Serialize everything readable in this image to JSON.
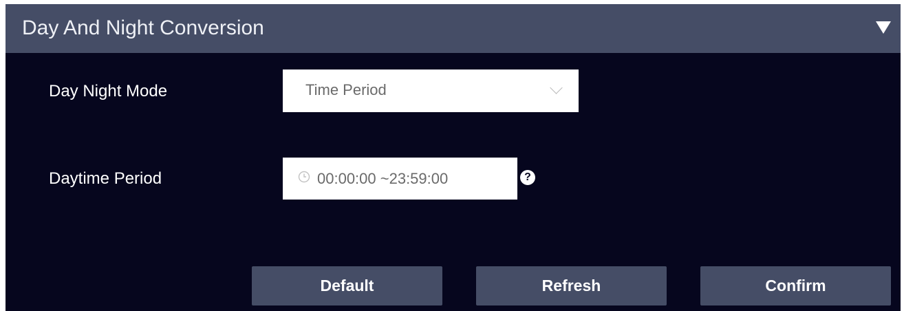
{
  "header": {
    "title": "Day And Night Conversion",
    "collapse_icon": "triangle-down-icon"
  },
  "form": {
    "day_night_mode": {
      "label": "Day Night Mode",
      "value": "Time Period",
      "icon": "chevron-down-icon"
    },
    "daytime_period": {
      "label": "Daytime Period",
      "value": "00:00:00  ~23:59:00",
      "icon": "clock-icon",
      "help": "?"
    }
  },
  "buttons": {
    "default_label": "Default",
    "refresh_label": "Refresh",
    "confirm_label": "Confirm"
  },
  "colors": {
    "panel_background": "#06061e",
    "header_background": "#454d66",
    "button_background": "#454d66"
  }
}
